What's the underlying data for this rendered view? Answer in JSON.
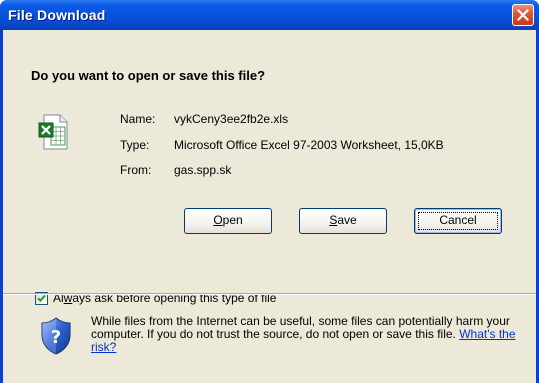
{
  "window": {
    "title": "File Download"
  },
  "dialog": {
    "question": "Do you want to open or save this file?",
    "file": {
      "name_label": "Name:",
      "name_value": "vykCeny3ee2fb2e.xls",
      "type_label": "Type:",
      "type_value": "Microsoft Office Excel 97-2003 Worksheet, 15,0KB",
      "from_label": "From:",
      "from_value": "gas.spp.sk",
      "icon": "excel-file-icon"
    },
    "buttons": {
      "open_label_accel": "O",
      "open_label_rest": "pen",
      "save_label_accel": "S",
      "save_label_rest": "ave",
      "cancel_label": "Cancel"
    },
    "checkbox": {
      "checked": true,
      "label_pre": "Al",
      "label_accel": "w",
      "label_post": "ays ask before opening this type of file"
    },
    "warning": {
      "icon": "security-shield-icon",
      "text": "While files from the Internet can be useful, some files can potentially harm your computer. If you do not trust the source, do not open or save this file.",
      "link": "What's the risk?"
    }
  },
  "colors": {
    "titlebar": "#0852dc",
    "dialog_bg": "#ece9d8",
    "link": "#0033cc",
    "close_button": "#dc5534"
  }
}
